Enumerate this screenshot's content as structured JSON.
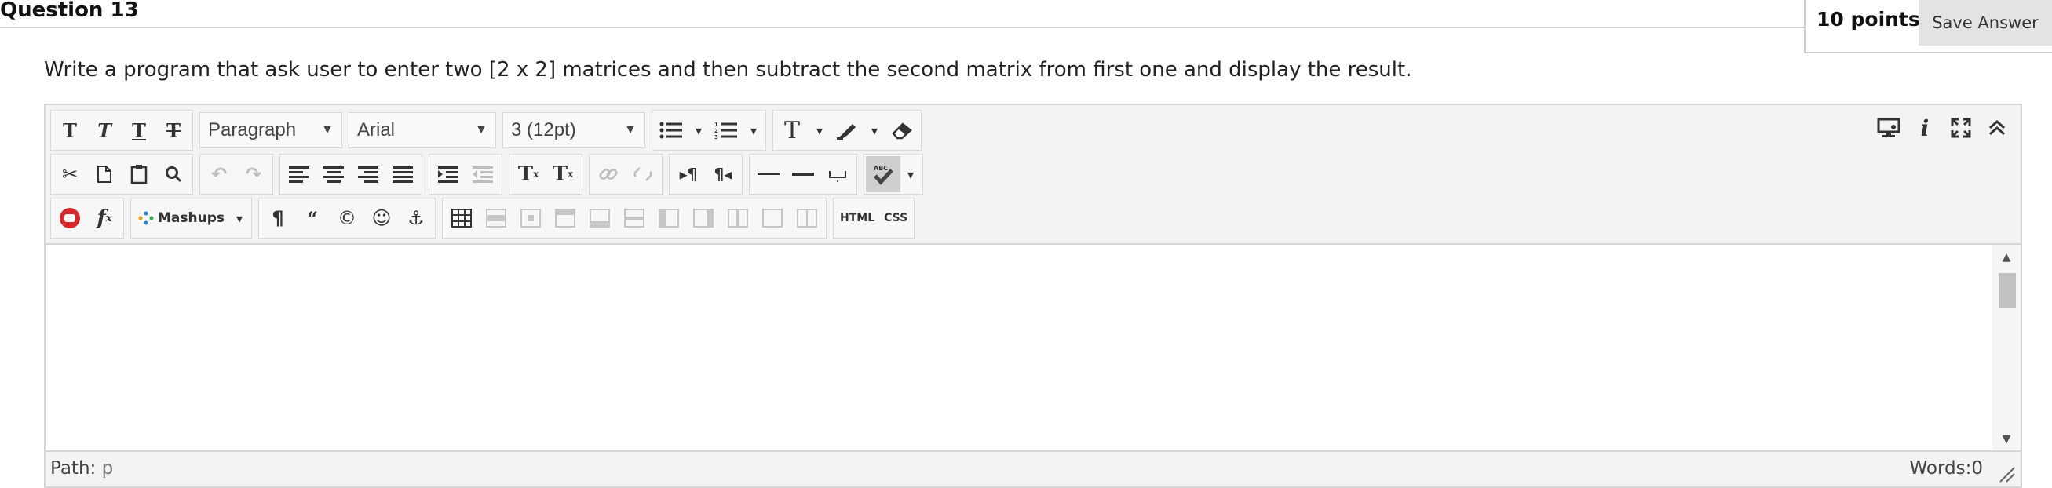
{
  "question": {
    "title": "Question 13",
    "points": "10 points",
    "save_label": "Save Answer",
    "prompt": "Write a program that ask user to enter two [2 x 2] matrices and then subtract the second matrix from first one and display the result."
  },
  "editor": {
    "format_dropdown": "Paragraph",
    "font_dropdown": "Arial",
    "size_dropdown": "3 (12pt)",
    "mashups_label": "Mashups",
    "html_label": "HTML",
    "css_label": "CSS",
    "path_label": "Path:",
    "path_value": "p",
    "words_label": "Words:0"
  },
  "icons": [
    "bold-icon",
    "italic-icon",
    "underline-icon",
    "strikethrough-icon",
    "bullet-list-icon",
    "numbered-list-icon",
    "text-color-icon",
    "highlight-icon",
    "eraser-icon",
    "cut-icon",
    "copy-icon",
    "paste-icon",
    "find-icon",
    "undo-icon",
    "redo-icon",
    "align-left-icon",
    "align-center-icon",
    "align-right-icon",
    "justify-icon",
    "indent-icon",
    "outdent-icon",
    "superscript-icon",
    "subscript-icon",
    "link-icon",
    "unlink-icon",
    "ltr-icon",
    "rtl-icon",
    "hr-icon",
    "hr-bold-icon",
    "nbsp-icon",
    "spellcheck-icon",
    "youtube-icon",
    "formula-icon",
    "mashups-icon",
    "pilcrow-icon",
    "quote-icon",
    "copyright-icon",
    "emoticon-icon",
    "anchor-icon",
    "table-icon",
    "preview-icon",
    "info-icon",
    "fullscreen-icon",
    "collapse-icon"
  ]
}
